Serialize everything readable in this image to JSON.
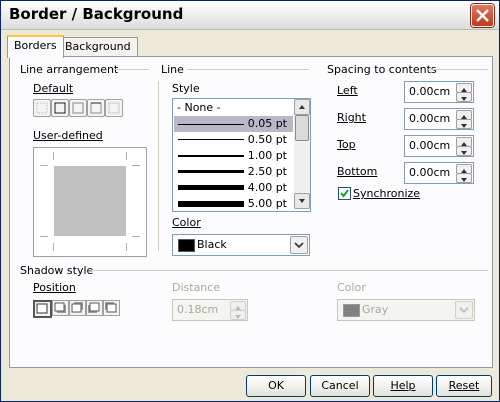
{
  "window": {
    "title": "Border / Background"
  },
  "tabs": [
    {
      "label": "Borders"
    },
    {
      "label": "Background"
    }
  ],
  "line_arrangement": {
    "heading": "Line arrangement",
    "default_label": "Default",
    "user_defined_label": "User-defined"
  },
  "line": {
    "heading": "Line",
    "style_label": "Style",
    "styles": [
      {
        "label": "- None -"
      },
      {
        "label": "0.05 pt"
      },
      {
        "label": "0.50 pt"
      },
      {
        "label": "1.00 pt"
      },
      {
        "label": "2.50 pt"
      },
      {
        "label": "4.00 pt"
      },
      {
        "label": "5.00 pt"
      }
    ],
    "selected_style": "0.05 pt",
    "color_label": "Color",
    "color_value": "Black",
    "color_hex": "#000000"
  },
  "spacing": {
    "heading": "Spacing to contents",
    "left_label": "Left",
    "left_value": "0.00cm",
    "right_label": "Right",
    "right_value": "0.00cm",
    "top_label": "Top",
    "top_value": "0.00cm",
    "bottom_label": "Bottom",
    "bottom_value": "0.00cm",
    "synchronize_label": "Synchronize",
    "synchronize_checked": true
  },
  "shadow": {
    "heading": "Shadow style",
    "position_label": "Position",
    "distance_label": "Distance",
    "distance_value": "0.18cm",
    "color_label": "Color",
    "color_value": "Gray",
    "color_hex": "#808080"
  },
  "buttons": {
    "ok": "OK",
    "cancel": "Cancel",
    "help": "Help",
    "reset": "Reset"
  }
}
